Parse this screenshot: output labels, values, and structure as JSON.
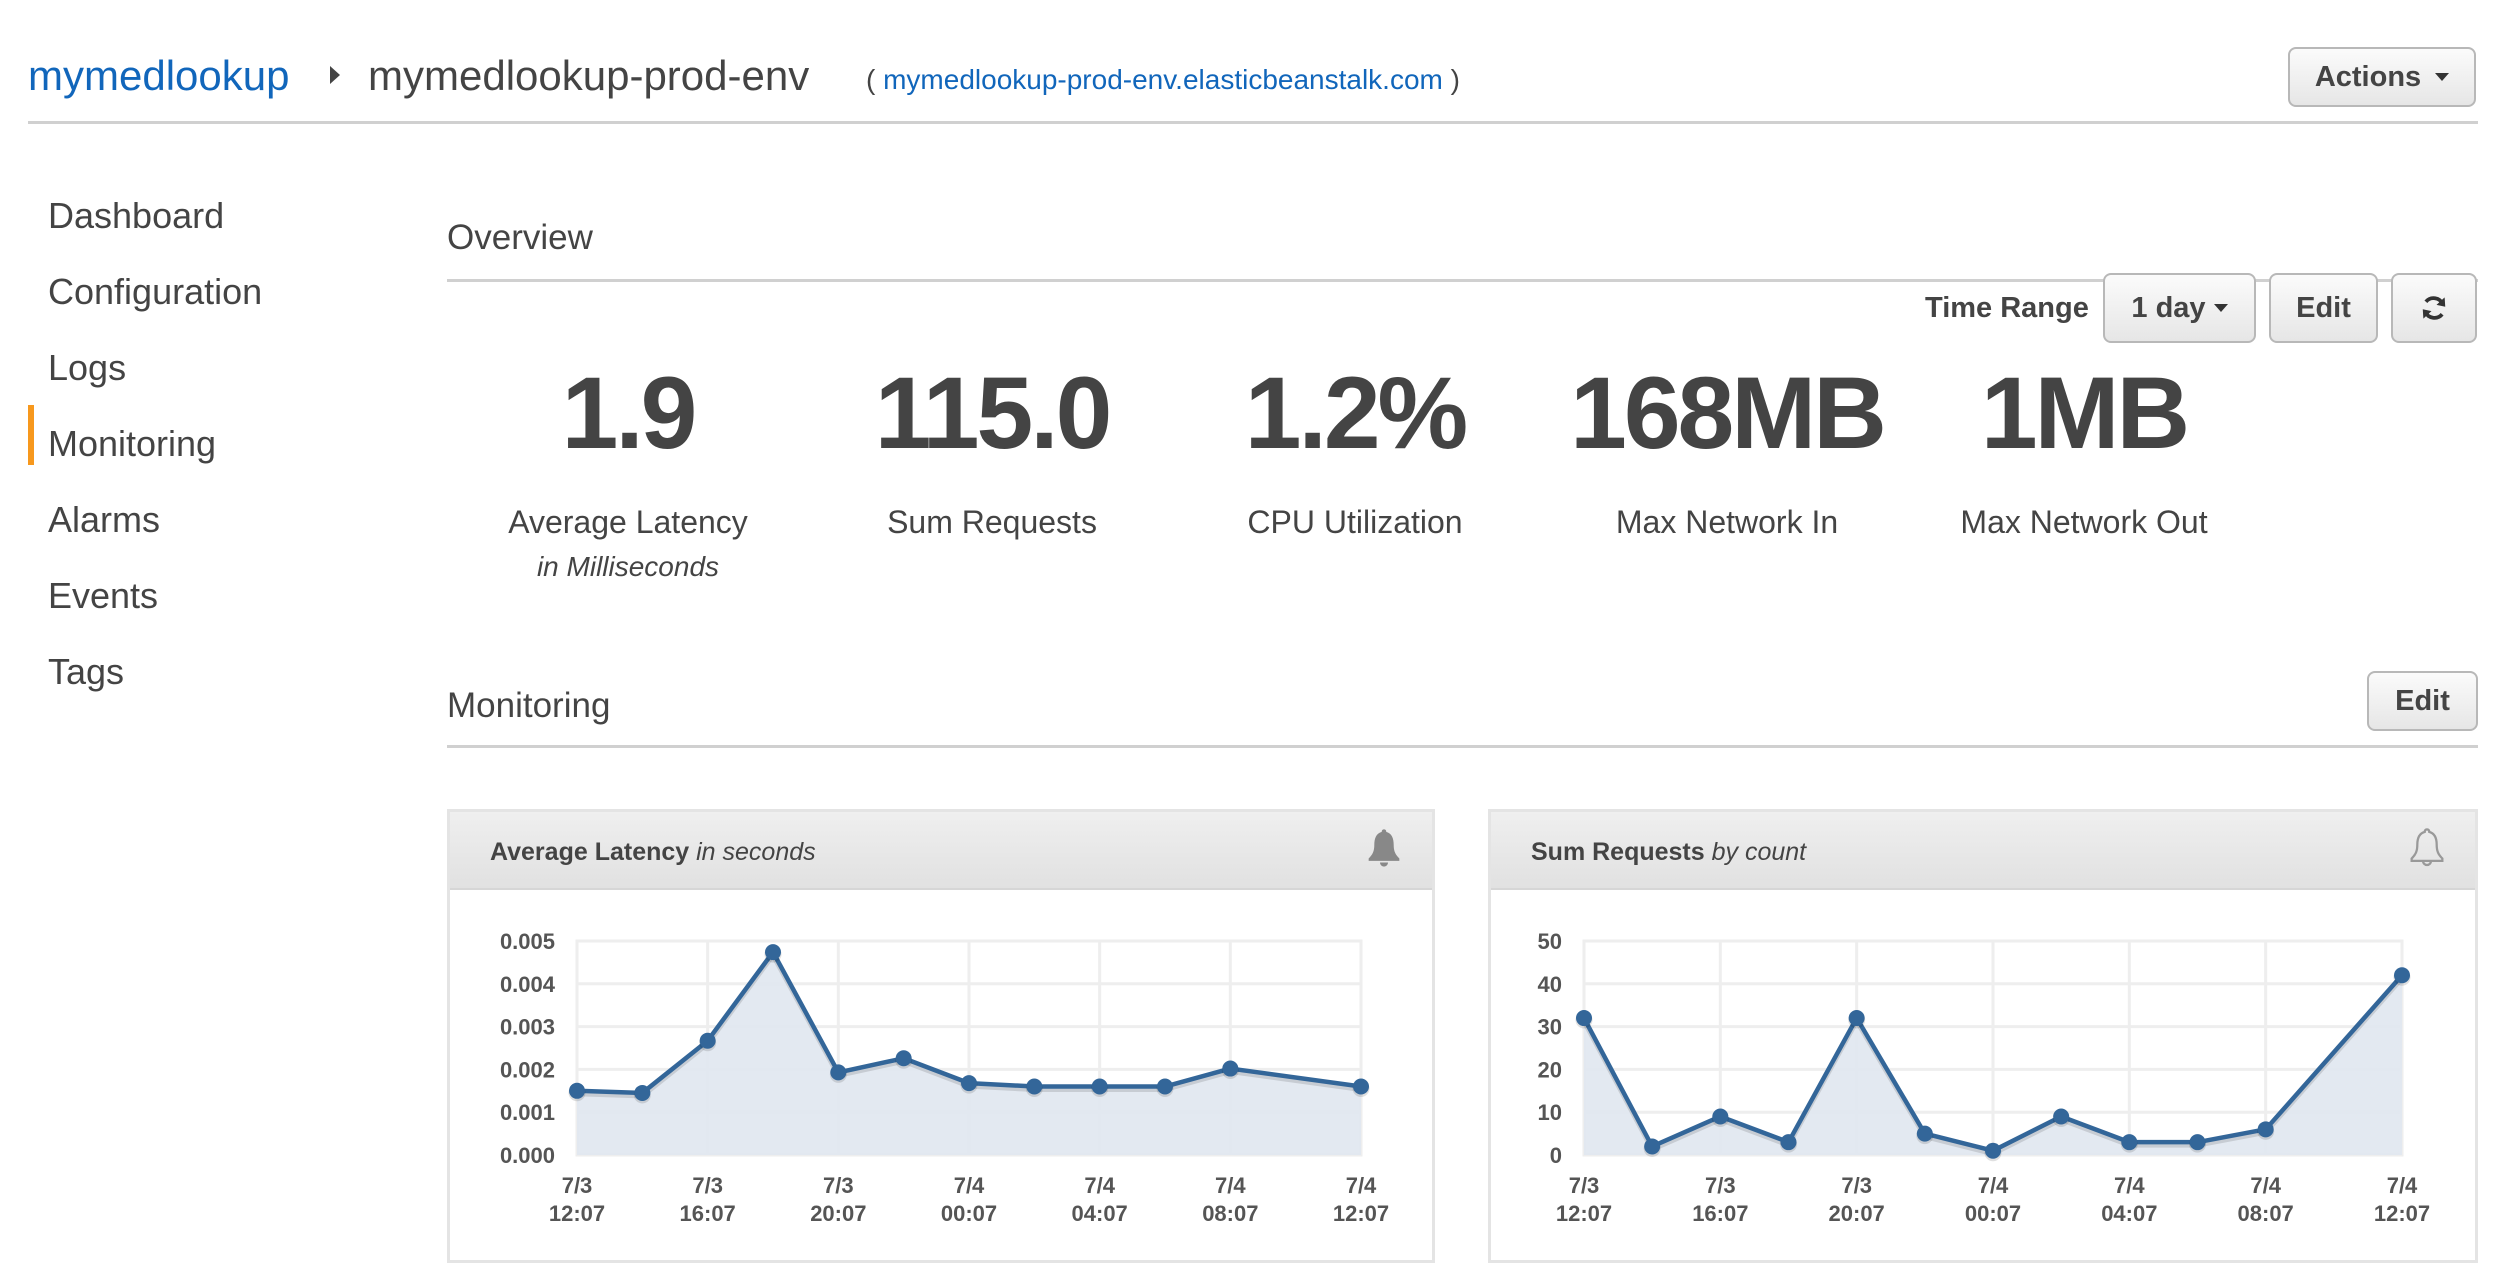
{
  "header": {
    "app_name": "mymedlookup",
    "environment_name": "mymedlookup-prod-env",
    "url_open": "( ",
    "url": "mymedlookup-prod-env.elasticbeanstalk.com",
    "url_close": " )",
    "actions_label": "Actions"
  },
  "sidebar": {
    "active": "Monitoring",
    "items": [
      {
        "label": "Dashboard"
      },
      {
        "label": "Configuration"
      },
      {
        "label": "Logs"
      },
      {
        "label": "Monitoring"
      },
      {
        "label": "Alarms"
      },
      {
        "label": "Events"
      },
      {
        "label": "Tags"
      }
    ]
  },
  "overview": {
    "title": "Overview",
    "time_range_label": "Time Range",
    "time_range_value": "1 day",
    "edit_label": "Edit",
    "refresh_icon": "refresh-icon",
    "stats": [
      {
        "value": "1.9",
        "label": "Average Latency",
        "sublabel": "in Milliseconds"
      },
      {
        "value": "115.0",
        "label": "Sum Requests",
        "sublabel": ""
      },
      {
        "value": "1.2%",
        "label": "CPU Utilization",
        "sublabel": ""
      },
      {
        "value": "168MB",
        "label": "Max Network In",
        "sublabel": ""
      },
      {
        "value": "1MB",
        "label": "Max Network Out",
        "sublabel": ""
      }
    ]
  },
  "monitoring": {
    "title": "Monitoring",
    "edit_label": "Edit"
  },
  "colors": {
    "link": "#1166bb",
    "active_indicator": "#f7981d",
    "series_line": "#336699",
    "series_fill": "#e0e7f0"
  },
  "chart_data": [
    {
      "type": "area",
      "title": "Average Latency",
      "title_unit": "in seconds",
      "alarm_icon": "bell-filled-icon",
      "x_unit": "hours since 7/3 12:07 (2h slots)",
      "x": [
        0,
        2,
        4,
        6,
        8,
        10,
        12,
        14,
        16,
        18,
        20,
        24
      ],
      "values": [
        0.0015,
        0.00145,
        0.00267,
        0.00474,
        0.00193,
        0.00226,
        0.00168,
        0.0016,
        0.0016,
        0.0016,
        0.00202,
        0.0016
      ],
      "xlim": [
        0,
        24
      ],
      "ylim": [
        0,
        0.005
      ],
      "yticks": [
        "0.000",
        "0.001",
        "0.002",
        "0.003",
        "0.004",
        "0.005"
      ],
      "xtick_positions": [
        0,
        4,
        8,
        12,
        16,
        20,
        24
      ],
      "xticks": [
        [
          "7/3",
          "12:07"
        ],
        [
          "7/3",
          "16:07"
        ],
        [
          "7/3",
          "20:07"
        ],
        [
          "7/4",
          "00:07"
        ],
        [
          "7/4",
          "04:07"
        ],
        [
          "7/4",
          "08:07"
        ],
        [
          "7/4",
          "12:07"
        ]
      ],
      "grid": true
    },
    {
      "type": "area",
      "title": "Sum Requests",
      "title_unit": "by count",
      "alarm_icon": "bell-outline-icon",
      "x_unit": "hours since 7/3 12:07 (2h slots)",
      "x": [
        0,
        2,
        4,
        6,
        8,
        10,
        12,
        14,
        16,
        18,
        20,
        24
      ],
      "values": [
        32,
        2,
        9,
        3,
        32,
        5,
        1,
        9,
        3,
        3,
        6,
        42
      ],
      "xlim": [
        0,
        24
      ],
      "ylim": [
        0,
        50
      ],
      "yticks": [
        "0",
        "10",
        "20",
        "30",
        "40",
        "50"
      ],
      "xtick_positions": [
        0,
        4,
        8,
        12,
        16,
        20,
        24
      ],
      "xticks": [
        [
          "7/3",
          "12:07"
        ],
        [
          "7/3",
          "16:07"
        ],
        [
          "7/3",
          "20:07"
        ],
        [
          "7/4",
          "00:07"
        ],
        [
          "7/4",
          "04:07"
        ],
        [
          "7/4",
          "08:07"
        ],
        [
          "7/4",
          "12:07"
        ]
      ],
      "grid": true
    }
  ]
}
